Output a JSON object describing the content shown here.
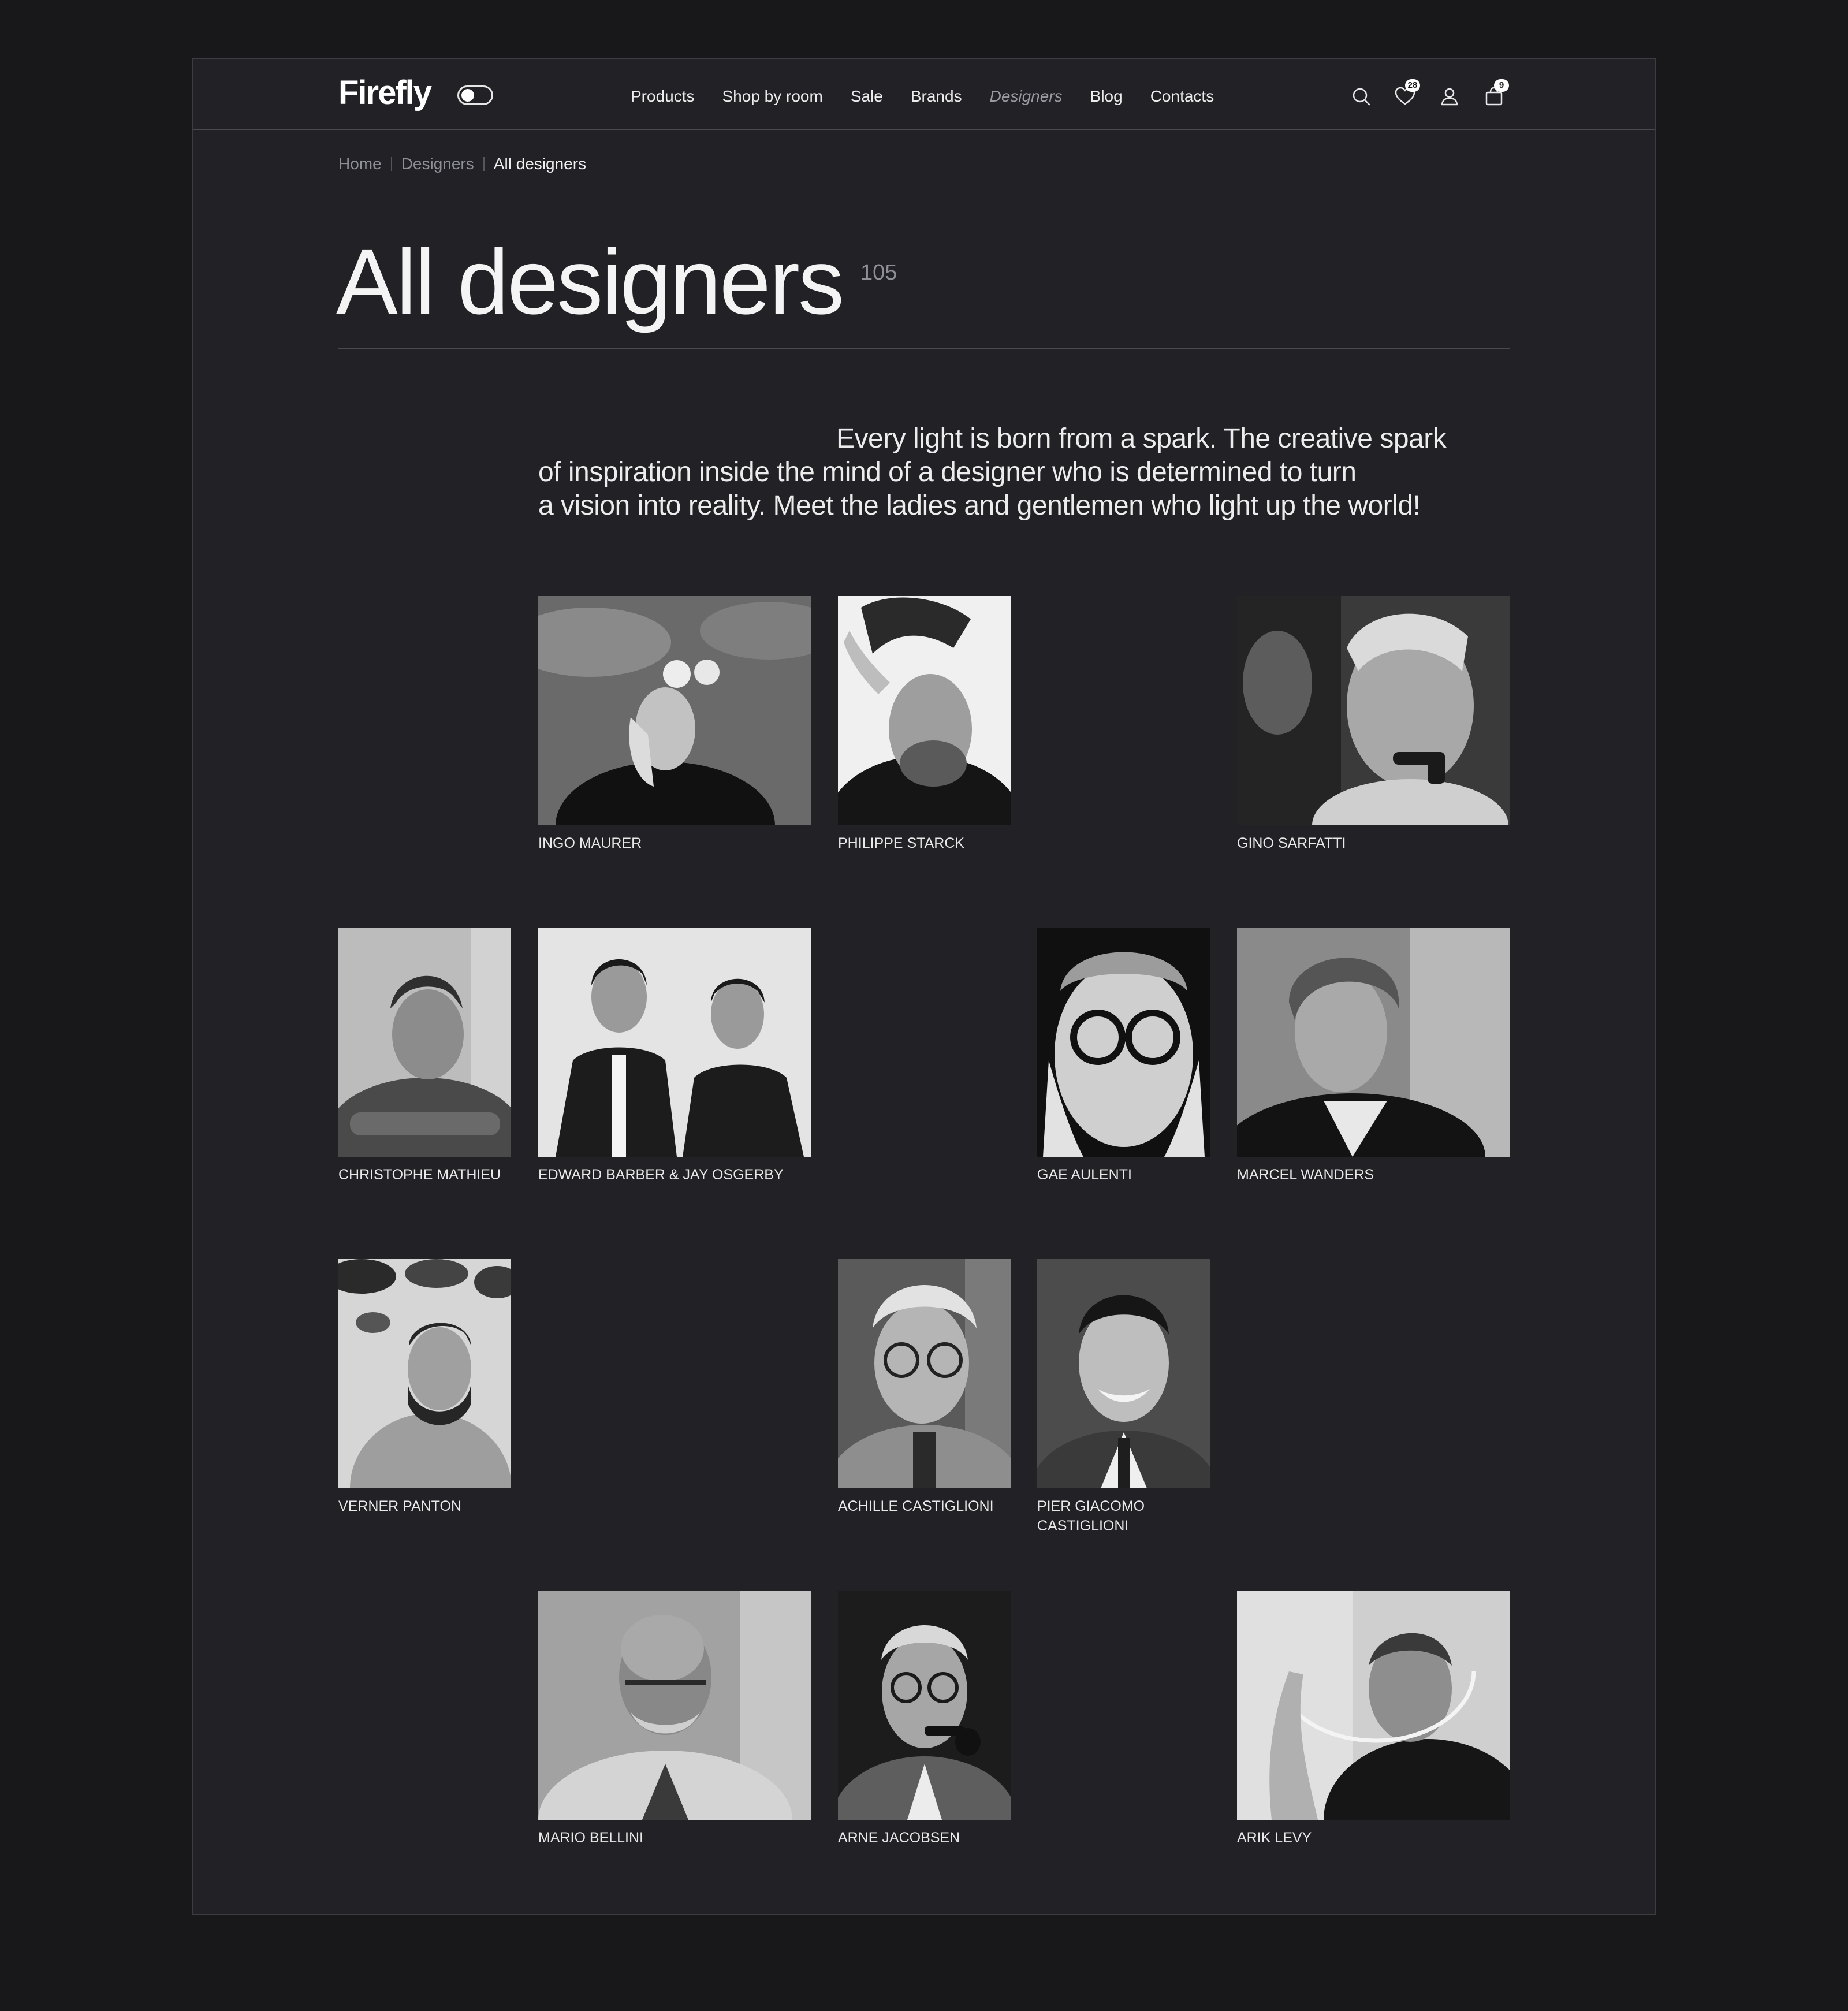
{
  "header": {
    "logo": "Firefly",
    "nav": [
      {
        "label": "Products"
      },
      {
        "label": "Shop by room"
      },
      {
        "label": "Sale"
      },
      {
        "label": "Brands"
      },
      {
        "label": "Designers",
        "active": true
      },
      {
        "label": "Blog"
      },
      {
        "label": "Contacts"
      }
    ],
    "wishlist_count": "28",
    "cart_count": "9"
  },
  "breadcrumb": [
    "Home",
    "Designers",
    "All designers"
  ],
  "page": {
    "title": "All designers",
    "count": "105",
    "intro_lines": [
      "Every light is born from a spark. The creative spark",
      "of inspiration inside the mind of a designer who is determined to turn",
      "a vision into reality. Meet the ladies and gentlemen who light up the world!"
    ]
  },
  "designers": [
    {
      "name": "INGO MAURER"
    },
    {
      "name": "PHILIPPE STARCK"
    },
    {
      "name": "GINO SARFATTI"
    },
    {
      "name": "CHRISTOPHE MATHIEU"
    },
    {
      "name": "EDWARD BARBER & JAY OSGERBY"
    },
    {
      "name": "GAE AULENTI"
    },
    {
      "name": "MARCEL WANDERS"
    },
    {
      "name": "VERNER PANTON"
    },
    {
      "name": "ACHILLE CASTIGLIONI"
    },
    {
      "name": "PIER GIACOMO CASTIGLIONI",
      "name_lines": [
        "PIER GIACOMO",
        "CASTIGLIONI"
      ]
    },
    {
      "name": "MARIO BELLINI"
    },
    {
      "name": "ARNE JACOBSEN"
    },
    {
      "name": "ARIK LEVY"
    }
  ],
  "colors": {
    "page_background": "#18181b",
    "frame_background": "#222126",
    "text": "#f2f2f2",
    "muted_text": "#8f8f96"
  }
}
